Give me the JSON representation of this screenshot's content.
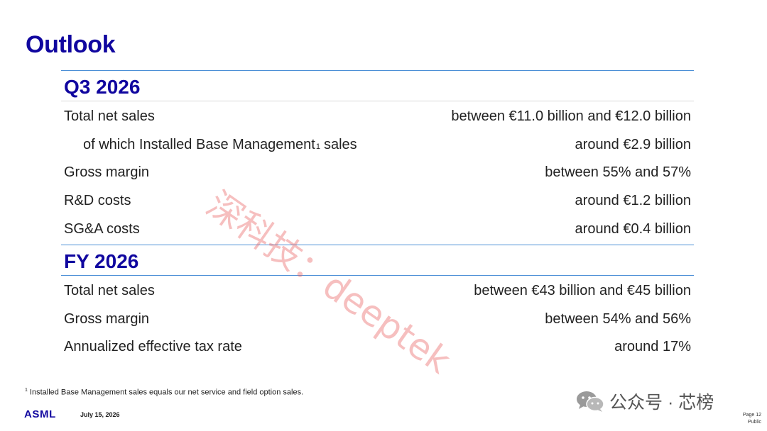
{
  "title": "Outlook",
  "sections": [
    {
      "heading": "Q3 2026",
      "rows": [
        {
          "label": "Total net sales",
          "value": "between €11.0 billion and €12.0 billion"
        },
        {
          "label": "of which Installed Base Management",
          "footnote_ref": "1",
          "label_suffix": "sales",
          "value": "around €2.9 billion"
        },
        {
          "label": "Gross margin",
          "value": "between 55% and 57%"
        },
        {
          "label": "R&D costs",
          "value": "around €1.2 billion"
        },
        {
          "label": "SG&A costs",
          "value": "around €0.4 billion"
        }
      ]
    },
    {
      "heading": "FY 2026",
      "rows": [
        {
          "label": "Total net sales",
          "value": "between €43 billion and €45 billion"
        },
        {
          "label": "Gross margin",
          "value": "between 54% and 56%"
        },
        {
          "label": "Annualized effective tax rate",
          "value": "around 17%"
        }
      ]
    }
  ],
  "footnote": {
    "marker": "1",
    "text": "Installed Base Management sales equals our net service and field option sales."
  },
  "footer": {
    "logo_text": "ASML",
    "date": "July 15, 2026",
    "page": "Page 12",
    "classification": "Public"
  },
  "watermark": "深科技：deeptek",
  "wechat_badge": "公众号 · 芯榜",
  "colors": {
    "title_blue": "#10069f",
    "rule_blue": "#4a8ed6",
    "watermark_red": "#e86060"
  }
}
